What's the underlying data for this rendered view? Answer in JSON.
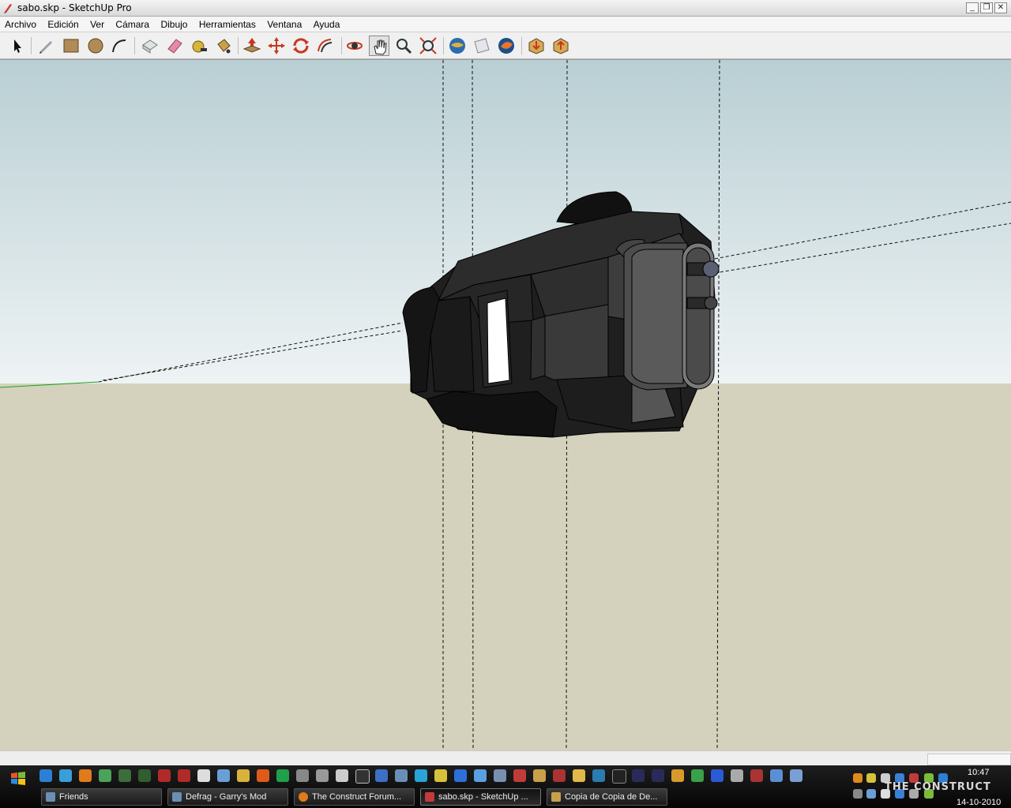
{
  "window": {
    "title": "sabo.skp - SketchUp Pro"
  },
  "menu": [
    "Archivo",
    "Edición",
    "Ver",
    "Cámara",
    "Dibujo",
    "Herramientas",
    "Ventana",
    "Ayuda"
  ],
  "toolbar": {
    "tools": [
      {
        "name": "select-tool",
        "icon": "arrow-icon"
      },
      {
        "name": "pencil-tool",
        "icon": "pencil-icon"
      },
      {
        "name": "rectangle-tool",
        "icon": "rectangle-icon"
      },
      {
        "name": "circle-tool",
        "icon": "circle-icon"
      },
      {
        "name": "arc-tool",
        "icon": "arc-icon"
      },
      {
        "name": "make-component-tool",
        "icon": "component-icon"
      },
      {
        "name": "eraser-tool",
        "icon": "eraser-icon"
      },
      {
        "name": "tape-measure-tool",
        "icon": "tape-measure-icon"
      },
      {
        "name": "paint-bucket-tool",
        "icon": "paint-bucket-icon"
      },
      {
        "name": "push-pull-tool",
        "icon": "push-pull-icon"
      },
      {
        "name": "move-tool",
        "icon": "move-icon"
      },
      {
        "name": "rotate-tool",
        "icon": "rotate-icon"
      },
      {
        "name": "offset-tool",
        "icon": "offset-icon"
      },
      {
        "name": "orbit-tool",
        "icon": "orbit-icon"
      },
      {
        "name": "pan-tool",
        "icon": "pan-hand-icon"
      },
      {
        "name": "zoom-tool",
        "icon": "zoom-icon"
      },
      {
        "name": "zoom-extents-tool",
        "icon": "zoom-extents-icon"
      },
      {
        "name": "previous-view-tool",
        "icon": "globe-icon"
      },
      {
        "name": "next-view-tool",
        "icon": "layer-icon"
      },
      {
        "name": "photo-textures-tool",
        "icon": "photo-textures-icon"
      },
      {
        "name": "warehouse-get-tool",
        "icon": "warehouse-get-icon"
      },
      {
        "name": "warehouse-share-tool",
        "icon": "warehouse-share-icon"
      }
    ]
  },
  "taskbar": {
    "tasks": [
      {
        "label": "Friends",
        "color": "#6a8fb5"
      },
      {
        "label": "Defrag - Garry's Mod",
        "color": "#6a8fb5"
      },
      {
        "label": "The Construct Forum...",
        "color": "#e07b1c"
      },
      {
        "label": "sabo.skp - SketchUp ...",
        "color": "#c23b3b"
      },
      {
        "label": "Copia de Copia de De...",
        "color": "#c9a04a"
      }
    ],
    "clock": {
      "time": "10:47",
      "date": "14-10-2010"
    },
    "watermark": "THE CONSTRUCT"
  },
  "colors": {
    "sky_top": "#b9cfd4",
    "sky_bottom": "#eef3f4",
    "ground": "#d4d2bc",
    "model": "#2b2b2b"
  }
}
